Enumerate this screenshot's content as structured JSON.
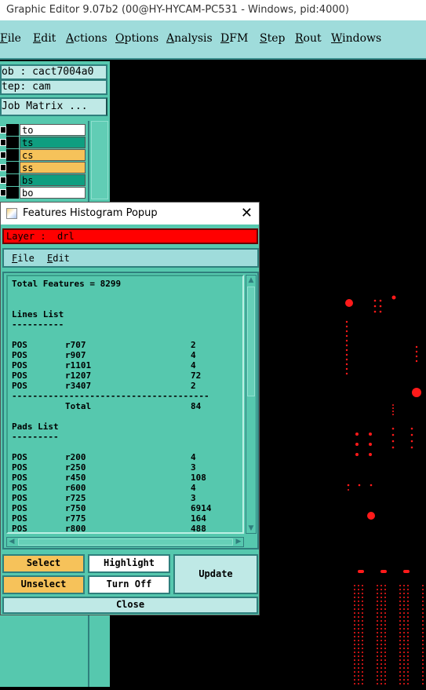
{
  "window": {
    "title": "Graphic Editor 9.07b2 (00@HY-HYCAM-PC531 - Windows, pid:4000)"
  },
  "menu": [
    {
      "label": "File",
      "u": "F"
    },
    {
      "label": "Edit",
      "u": "E"
    },
    {
      "label": "Actions",
      "u": "A"
    },
    {
      "label": "Options",
      "u": "O"
    },
    {
      "label": "Analysis",
      "u": "A"
    },
    {
      "label": "DFM",
      "u": "D"
    },
    {
      "label": "Step",
      "u": "S"
    },
    {
      "label": "Rout",
      "u": "R"
    },
    {
      "label": "Windows",
      "u": "W"
    }
  ],
  "left": {
    "job": "ob : cact7004a0",
    "step": "tep: cam",
    "matrix": "Job Matrix ...",
    "layers": [
      {
        "name": "to",
        "color": "#ffffff"
      },
      {
        "name": "ts",
        "color": "#0f9e80"
      },
      {
        "name": "cs",
        "color": "#f6c25a"
      },
      {
        "name": "ss",
        "color": "#f6c25a"
      },
      {
        "name": "bs",
        "color": "#0f9e80"
      },
      {
        "name": "bo",
        "color": "#ffffff"
      }
    ]
  },
  "popup": {
    "title": "Features Histogram Popup",
    "layer_label": "Layer :  drl",
    "menu": {
      "file": "File",
      "edit": "Edit"
    },
    "text_lines": [
      [
        "Total Features = 8299",
        "",
        ""
      ],
      [
        "",
        "",
        ""
      ],
      [
        "",
        "",
        ""
      ],
      [
        "Lines List",
        "",
        ""
      ],
      [
        "----------",
        "",
        ""
      ],
      [
        "",
        "",
        ""
      ],
      [
        "POS",
        "r707",
        "2"
      ],
      [
        "POS",
        "r907",
        "4"
      ],
      [
        "POS",
        "r1101",
        "4"
      ],
      [
        "POS",
        "r1207",
        "72"
      ],
      [
        "POS",
        "r3407",
        "2"
      ],
      [
        "--------------------------------------",
        "",
        ""
      ],
      [
        "",
        "Total",
        "84"
      ],
      [
        "",
        "",
        ""
      ],
      [
        "Pads List",
        "",
        ""
      ],
      [
        "---------",
        "",
        ""
      ],
      [
        "",
        "",
        ""
      ],
      [
        "POS",
        "r200",
        "4"
      ],
      [
        "POS",
        "r250",
        "3"
      ],
      [
        "POS",
        "r450",
        "108"
      ],
      [
        "POS",
        "r600",
        "4"
      ],
      [
        "POS",
        "r725",
        "3"
      ],
      [
        "POS",
        "r750",
        "6914"
      ],
      [
        "POS",
        "r775",
        "164"
      ],
      [
        "POS",
        "r800",
        "488"
      ]
    ],
    "buttons": {
      "select": "Select",
      "highlight": "Highlight",
      "unselect": "Unselect",
      "turn_off": "Turn Off",
      "update": "Update",
      "close": "Close"
    }
  },
  "colors": {
    "feature_red": "#ff1a1a",
    "panel": "#56c8ae",
    "menu": "#9fdcdb"
  }
}
